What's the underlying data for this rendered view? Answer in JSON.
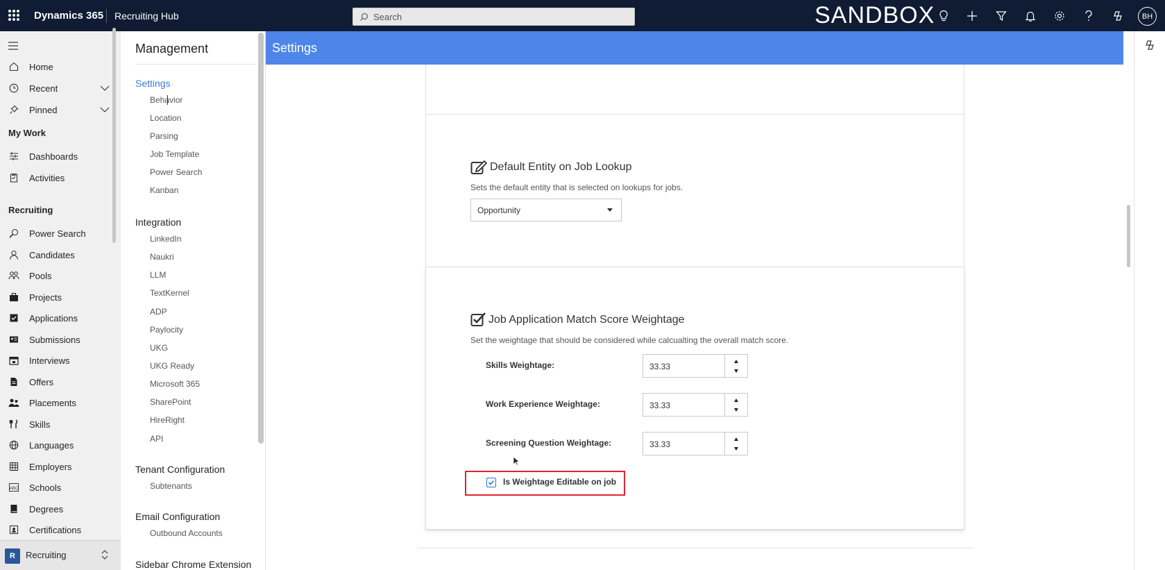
{
  "topbar": {
    "app_name": "Dynamics 365",
    "hub_name": "Recruiting Hub",
    "search_placeholder": "Search",
    "environment_label": "SANDBOX",
    "user_initials": "BH"
  },
  "leftnav": {
    "items_top": [
      {
        "label": "Home",
        "icon": "home-icon"
      },
      {
        "label": "Recent",
        "icon": "clock-icon"
      },
      {
        "label": "Pinned",
        "icon": "pin-icon"
      }
    ],
    "my_work_heading": "My Work",
    "my_work_items": [
      {
        "label": "Dashboards",
        "icon": "dashboard-icon"
      },
      {
        "label": "Activities",
        "icon": "clipboard-icon"
      }
    ],
    "recruiting_heading": "Recruiting",
    "recruiting_items": [
      {
        "label": "Power Search",
        "icon": "magnifier-icon"
      },
      {
        "label": "Candidates",
        "icon": "person-icon"
      },
      {
        "label": "Pools",
        "icon": "people-icon"
      },
      {
        "label": "Projects",
        "icon": "briefcase-icon"
      },
      {
        "label": "Applications",
        "icon": "checkbox-icon"
      },
      {
        "label": "Submissions",
        "icon": "id-card-icon"
      },
      {
        "label": "Interviews",
        "icon": "calendar-icon"
      },
      {
        "label": "Offers",
        "icon": "document-icon"
      },
      {
        "label": "Placements",
        "icon": "people-group-icon"
      },
      {
        "label": "Skills",
        "icon": "tools-icon"
      },
      {
        "label": "Languages",
        "icon": "globe-icon"
      },
      {
        "label": "Employers",
        "icon": "building-icon"
      },
      {
        "label": "Schools",
        "icon": "abc-icon"
      },
      {
        "label": "Degrees",
        "icon": "book-icon"
      },
      {
        "label": "Certifications",
        "icon": "certificate-icon"
      }
    ],
    "area": {
      "badge": "R",
      "label": "Recruiting"
    }
  },
  "management": {
    "title": "Management",
    "groups": [
      {
        "label": "Settings",
        "active": true,
        "links": [
          "Behavior",
          "Location",
          "Parsing",
          "Job Template",
          "Power Search",
          "Kanban"
        ]
      },
      {
        "label": "Integration",
        "active": false,
        "links": [
          "LinkedIn",
          "Naukri",
          "LLM",
          "TextKernel",
          "ADP",
          "Paylocity",
          "UKG",
          "UKG Ready",
          "Microsoft 365",
          "SharePoint",
          "HireRight",
          "API"
        ]
      },
      {
        "label": "Tenant Configuration",
        "active": false,
        "links": [
          "Subtenants"
        ]
      },
      {
        "label": "Email Configuration",
        "active": false,
        "links": [
          "Outbound Accounts"
        ]
      },
      {
        "label": "Sidebar Chrome Extension",
        "active": false,
        "links": []
      }
    ]
  },
  "main": {
    "header": "Settings",
    "default_entity": {
      "title": "Default Entity on Job Lookup",
      "description": "Sets the default entity that is selected on lookups for jobs.",
      "selected": "Opportunity"
    },
    "match_score": {
      "title": "Job Application Match Score Weightage",
      "description": "Set the weightage that should be considered while calcualting the overall match score.",
      "fields": [
        {
          "label": "Skills Weightage:",
          "value": "33.33"
        },
        {
          "label": "Work Experience Weightage:",
          "value": "33.33"
        },
        {
          "label": "Screening Question Weightage:",
          "value": "33.33"
        }
      ],
      "checkbox_label": "Is Weightage Editable on job",
      "checkbox_checked": true
    }
  },
  "colors": {
    "topbar_bg": "#0f1c33",
    "settings_bar": "#4d86e8",
    "active_link": "#3b7ddd",
    "highlight_border": "#e0232e"
  }
}
